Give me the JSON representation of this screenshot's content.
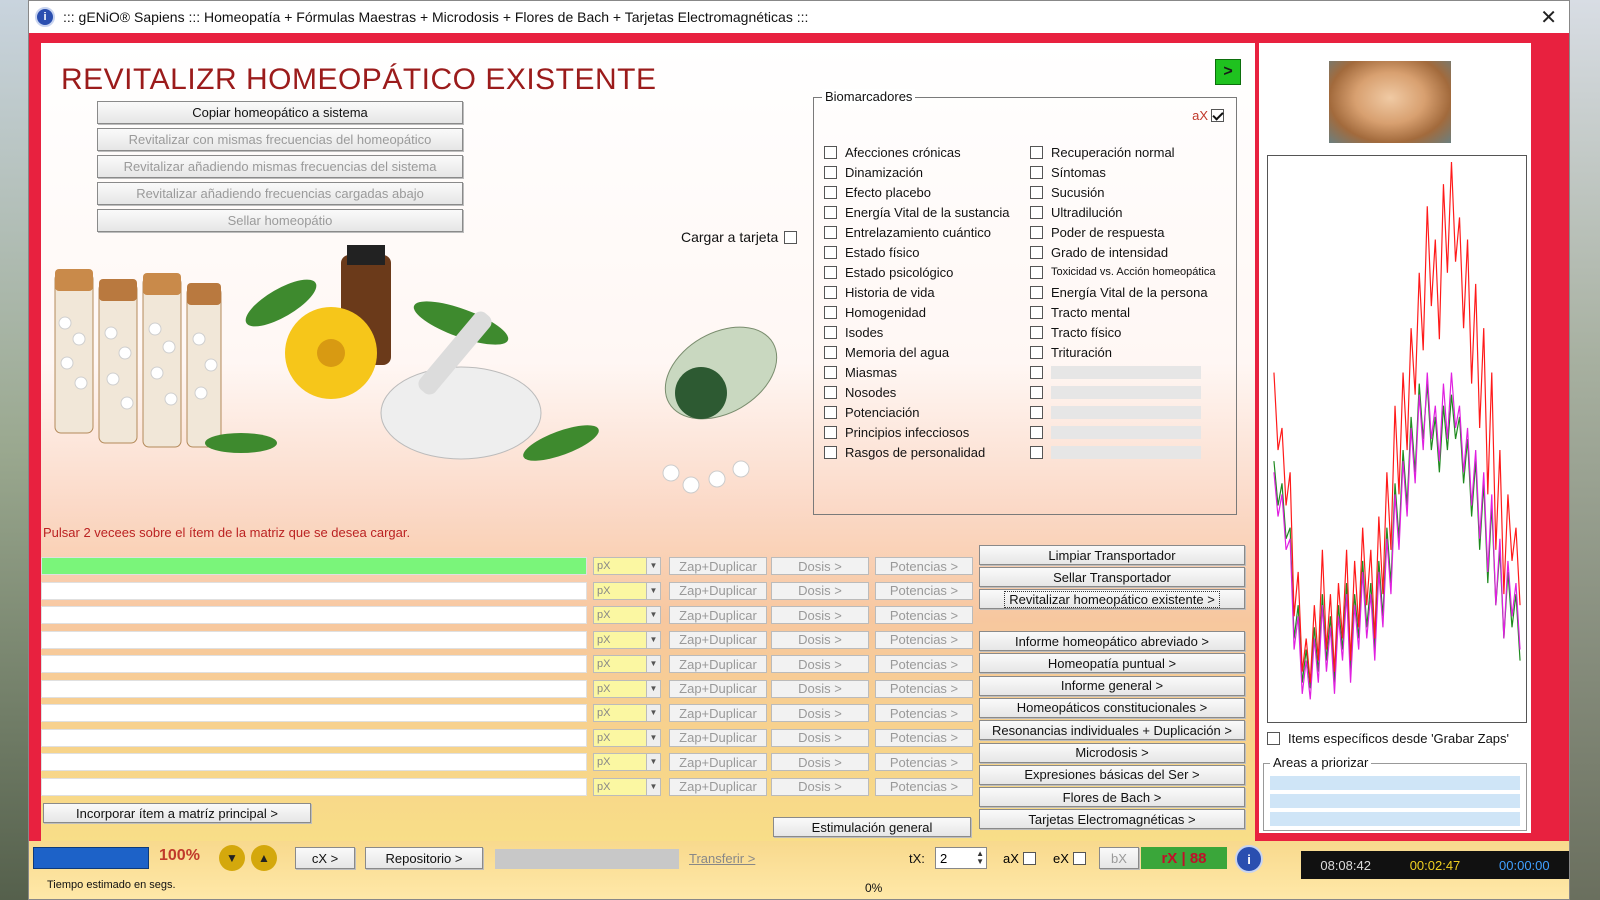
{
  "window": {
    "title": "::: gENiO® Sapiens ::: Homeopatía + Fórmulas Maestras + Microdosis + Flores de Bach + Tarjetas Electromagnéticas :::"
  },
  "page_title": "REVITALIZR HOMEOPÁTICO EXISTENTE",
  "go_label": ">",
  "actions": [
    {
      "label": "Copiar homeopático a sistema",
      "enabled": true
    },
    {
      "label": "Revitalizar con mismas frecuencias del homeopático",
      "enabled": false
    },
    {
      "label": "Revitalizar añadiendo mismas frecuencias del sistema",
      "enabled": false
    },
    {
      "label": "Revitalizar añadiendo frecuencias cargadas abajo",
      "enabled": false
    },
    {
      "label": "Sellar homeopátio",
      "enabled": false
    }
  ],
  "cargar_tarjeta": "Cargar a tarjeta",
  "biomarkers": {
    "legend": "Biomarcadores",
    "ax_label": "aX",
    "left": [
      "Afecciones crónicas",
      "Dinamización",
      "Efecto placebo",
      "Energía Vital de la sustancia",
      "Entrelazamiento cuántico",
      "Estado físico",
      "Estado psicológico",
      "Historia de vida",
      "Homogenidad",
      "Isodes",
      "Memoria del agua",
      "Miasmas",
      "Nosodes",
      "Potenciación",
      "Principios infecciosos",
      "Rasgos de personalidad"
    ],
    "right": [
      "Recuperación normal",
      "Síntomas",
      "Sucusión",
      "Ultradilución",
      "Poder de respuesta",
      "Grado de intensidad",
      "Toxicidad vs. Acción homeopática",
      "Energía Vital de la persona",
      "Tracto mental",
      "Tracto físico",
      "Trituración",
      "",
      "",
      "",
      "",
      ""
    ]
  },
  "hint": "Pulsar 2 vecees sobre el ítem de la matriz que se desea cargar.",
  "matrix": {
    "px_label": "pX",
    "zap_label": "Zap+Duplicar",
    "dosis_label": "Dosis >",
    "potencias_label": "Potencias >",
    "row_count": 10,
    "incorporar_label": "Incorporar ítem a matríz principal >"
  },
  "transport": [
    {
      "label": "Limpiar Transportador"
    },
    {
      "label": "Sellar Transportador"
    },
    {
      "label": "Revitalizar homeopático existente >"
    }
  ],
  "reports": [
    "Informe homeopático abreviado >",
    "Homeopatía puntual >",
    "Informe general >",
    "Homeopáticos constitucionales >",
    "Resonancias individuales + Duplicación >",
    "Microdosis >",
    "Expresiones básicas del Ser >",
    "Flores de Bach >",
    "Tarjetas Electromagnéticas >"
  ],
  "estimulacion_label": "Estimulación general",
  "right_panel": {
    "items_label": "Items específicos desde 'Grabar Zaps'",
    "areas_legend": "Areas a priorizar"
  },
  "bottom": {
    "progress_pct": "100%",
    "estimado": "Tiempo estimado en segs.",
    "cx_label": "cX >",
    "repositorio_label": "Repositorio >",
    "transferir_label": "Transferir >",
    "zero_pct": "0%",
    "tx_label": "tX:",
    "tx_value": "2",
    "ax_label": "aX",
    "ex_label": "eX",
    "bx_label": "bX",
    "rx_label": "rX | 88",
    "time1": "08:08:42",
    "time2": "00:02:47",
    "time3": "00:00:00"
  },
  "colors": {
    "accent_red": "#e8213f",
    "title_red": "#9b1b1b",
    "row_active_green": "#7af57a",
    "chart_red": "#ff1a1a",
    "chart_magenta": "#e020e0",
    "chart_green": "#1f8a1f"
  },
  "chart_data": {
    "type": "line",
    "series": [
      {
        "values": [
          62,
          48,
          52,
          38,
          44,
          18,
          26,
          8,
          14,
          6,
          20,
          10,
          30,
          12,
          22,
          8,
          24,
          14,
          30,
          10,
          28,
          16,
          34,
          20,
          30,
          14,
          36,
          22,
          44,
          30,
          56,
          40,
          62,
          48,
          70,
          58,
          80,
          66,
          92,
          74,
          86,
          68,
          96,
          80,
          100,
          82,
          90,
          70,
          86,
          60,
          78,
          52,
          70,
          40,
          62,
          30,
          48,
          22,
          40,
          28,
          34,
          20
        ]
      },
      {
        "values": [
          44,
          36,
          40,
          30,
          32,
          12,
          18,
          4,
          10,
          3,
          14,
          6,
          20,
          8,
          16,
          4,
          18,
          10,
          22,
          6,
          20,
          12,
          26,
          14,
          22,
          10,
          26,
          16,
          32,
          22,
          40,
          30,
          46,
          36,
          52,
          42,
          58,
          48,
          62,
          50,
          56,
          46,
          60,
          50,
          62,
          52,
          56,
          44,
          52,
          38,
          48,
          32,
          44,
          26,
          40,
          20,
          32,
          14,
          28,
          18,
          24,
          12
        ]
      },
      {
        "values": [
          46,
          38,
          42,
          32,
          34,
          14,
          20,
          6,
          12,
          5,
          16,
          8,
          22,
          10,
          18,
          6,
          20,
          12,
          24,
          8,
          22,
          14,
          28,
          16,
          24,
          12,
          28,
          18,
          34,
          24,
          42,
          32,
          48,
          38,
          54,
          44,
          60,
          50,
          60,
          48,
          54,
          44,
          56,
          48,
          58,
          50,
          54,
          42,
          50,
          36,
          46,
          30,
          42,
          24,
          38,
          20,
          30,
          14,
          26,
          16,
          22,
          10
        ]
      }
    ],
    "ylim": [
      0,
      100
    ]
  }
}
